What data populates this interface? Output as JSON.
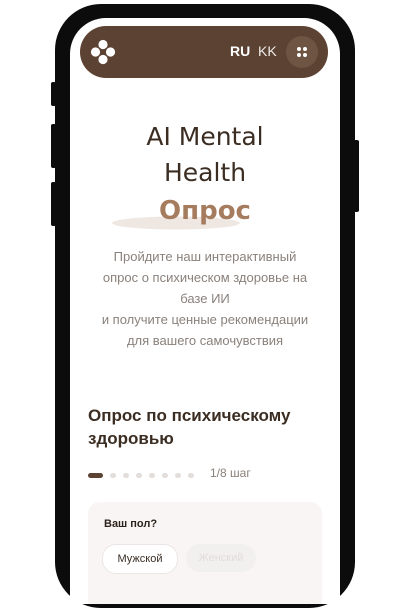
{
  "header": {
    "logo_icon": "diamond-dots-logo-icon",
    "lang_ru": "RU",
    "lang_kk": "KK",
    "menu_icon": "grid-dots-icon",
    "bg_color": "#5b4232"
  },
  "hero": {
    "title_line1": "AI Mental",
    "title_line2": "Health",
    "title_accent": "Опрос",
    "accent_color": "#a67c5e",
    "description_lines": [
      "Пройдите наш интерактивный",
      "опрос о психическом здоровье на",
      "базе ИИ",
      "и получите ценные рекомендации",
      "для вашего самочувствия"
    ]
  },
  "survey": {
    "section_title_line1": "Опрос по психическому",
    "section_title_line2": "здоровью",
    "progress": {
      "current": 1,
      "total": 8
    },
    "step_label": "1/8 шаг",
    "question": "Ваш пол?",
    "options": [
      "Мужской",
      "Женский"
    ]
  }
}
